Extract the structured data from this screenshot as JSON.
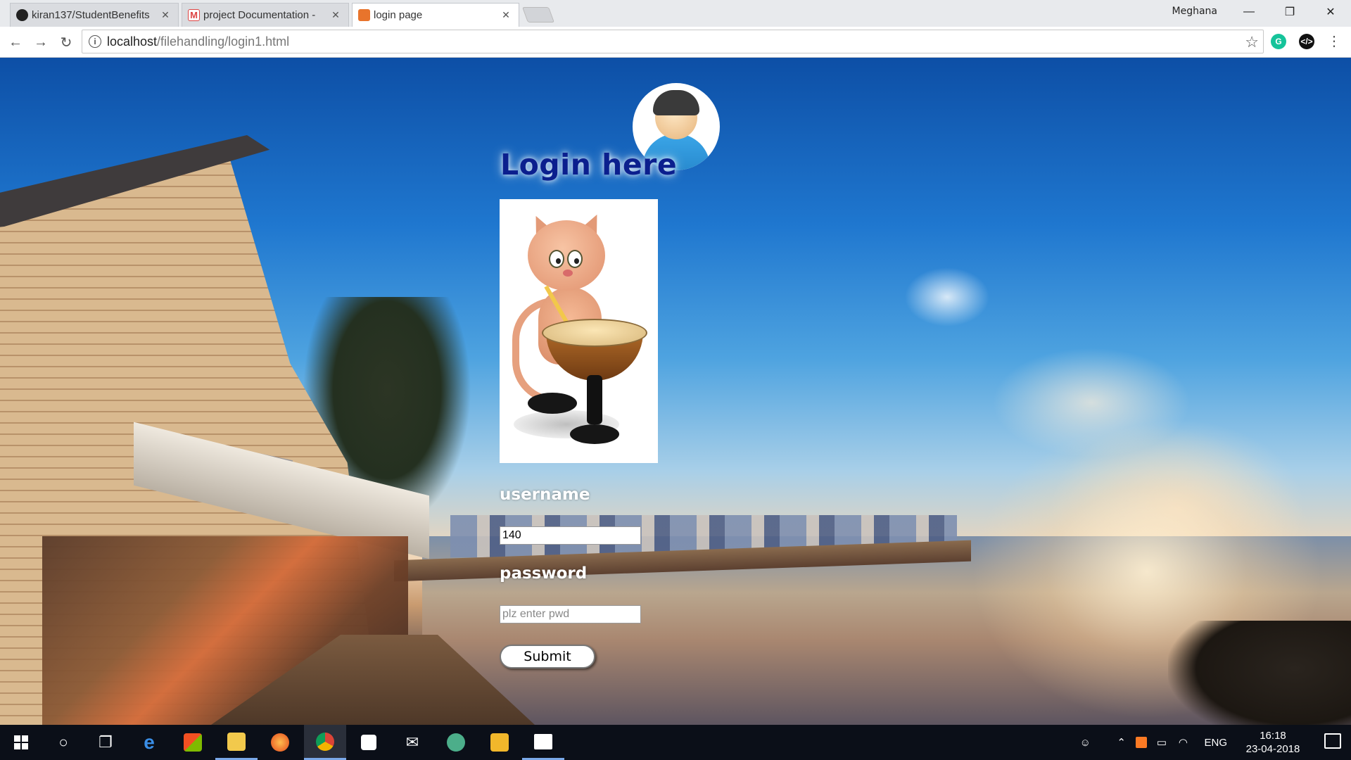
{
  "browser": {
    "tabs": [
      {
        "title": "kiran137/StudentBenefits",
        "icon": "github-icon",
        "active": false
      },
      {
        "title": "project Documentation -",
        "icon": "gmail-icon",
        "active": false
      },
      {
        "title": "login page",
        "icon": "html-icon",
        "active": true
      }
    ],
    "profile_name": "Meghana",
    "url_host": "localhost",
    "url_path": "/filehandling/login1.html",
    "extensions": [
      "grammarly-icon",
      "code-icon"
    ]
  },
  "page": {
    "heading": "Login here",
    "username_label": "username",
    "username_value": "140",
    "password_label": "password",
    "password_placeholder": "plz enter pwd",
    "submit_label": "Submit",
    "heading_color": "#0b1f8e"
  },
  "taskbar": {
    "apps": [
      "windows-start-icon",
      "cortana-icon",
      "task-view-icon",
      "edge-icon",
      "store-icon",
      "file-explorer-icon",
      "firefox-icon",
      "chrome-icon",
      "sticky-notes-icon",
      "mail-icon",
      "atom-icon",
      "outlook-icon",
      "photos-icon"
    ],
    "language": "ENG",
    "time": "16:18",
    "date": "23-04-2018"
  }
}
